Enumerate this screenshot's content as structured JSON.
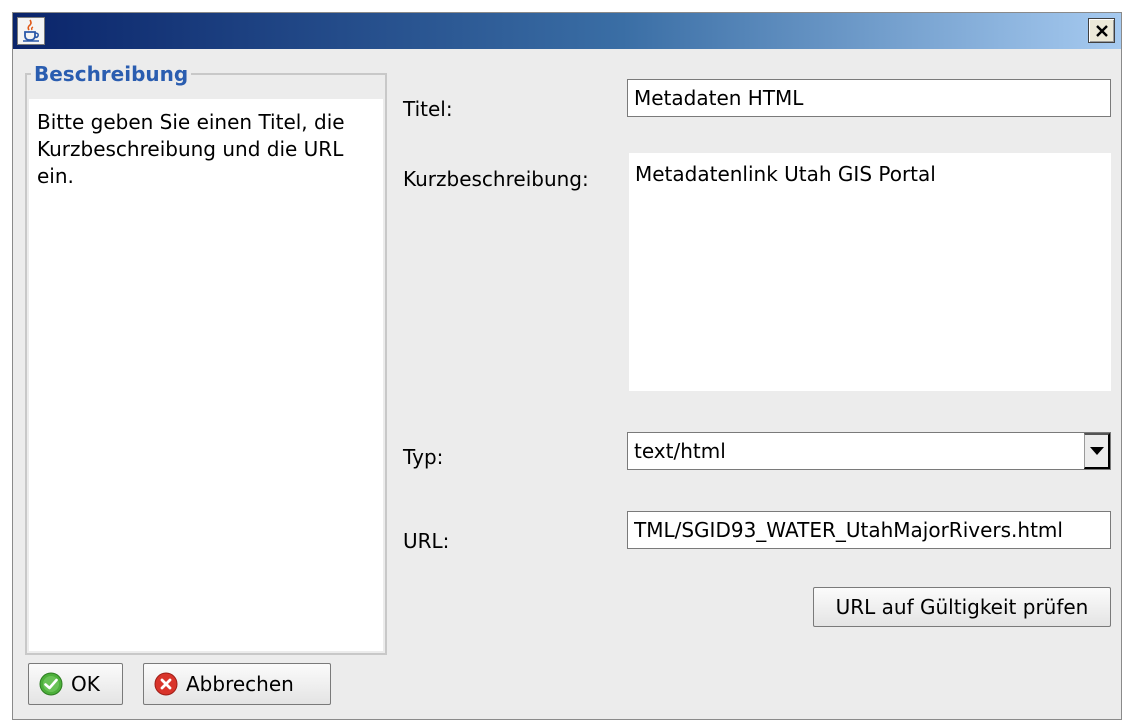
{
  "window": {
    "close_symbol": "×"
  },
  "description": {
    "title": "Beschreibung",
    "text": "Bitte geben Sie einen Titel, die Kurzbeschreibung und die URL ein."
  },
  "form": {
    "title_label": "Titel:",
    "title_value": "Metadaten HTML",
    "short_desc_label": "Kurzbeschreibung:",
    "short_desc_value": "Metadatenlink Utah GIS Portal",
    "type_label": "Typ:",
    "type_value": "text/html",
    "url_label": "URL:",
    "url_value": "TML/SGID93_WATER_UtahMajorRivers.html",
    "check_url_label": "URL auf Gültigkeit prüfen"
  },
  "buttons": {
    "ok_label": "OK",
    "cancel_label": "Abbrechen"
  },
  "icons": {
    "app": "java-cup-icon",
    "ok": "green-check-icon",
    "cancel": "red-x-icon",
    "dropdown": "triangle-down-icon"
  },
  "colors": {
    "group_title": "#2a5db0",
    "ok_green": "#4caf3a",
    "cancel_red": "#d9342b"
  }
}
